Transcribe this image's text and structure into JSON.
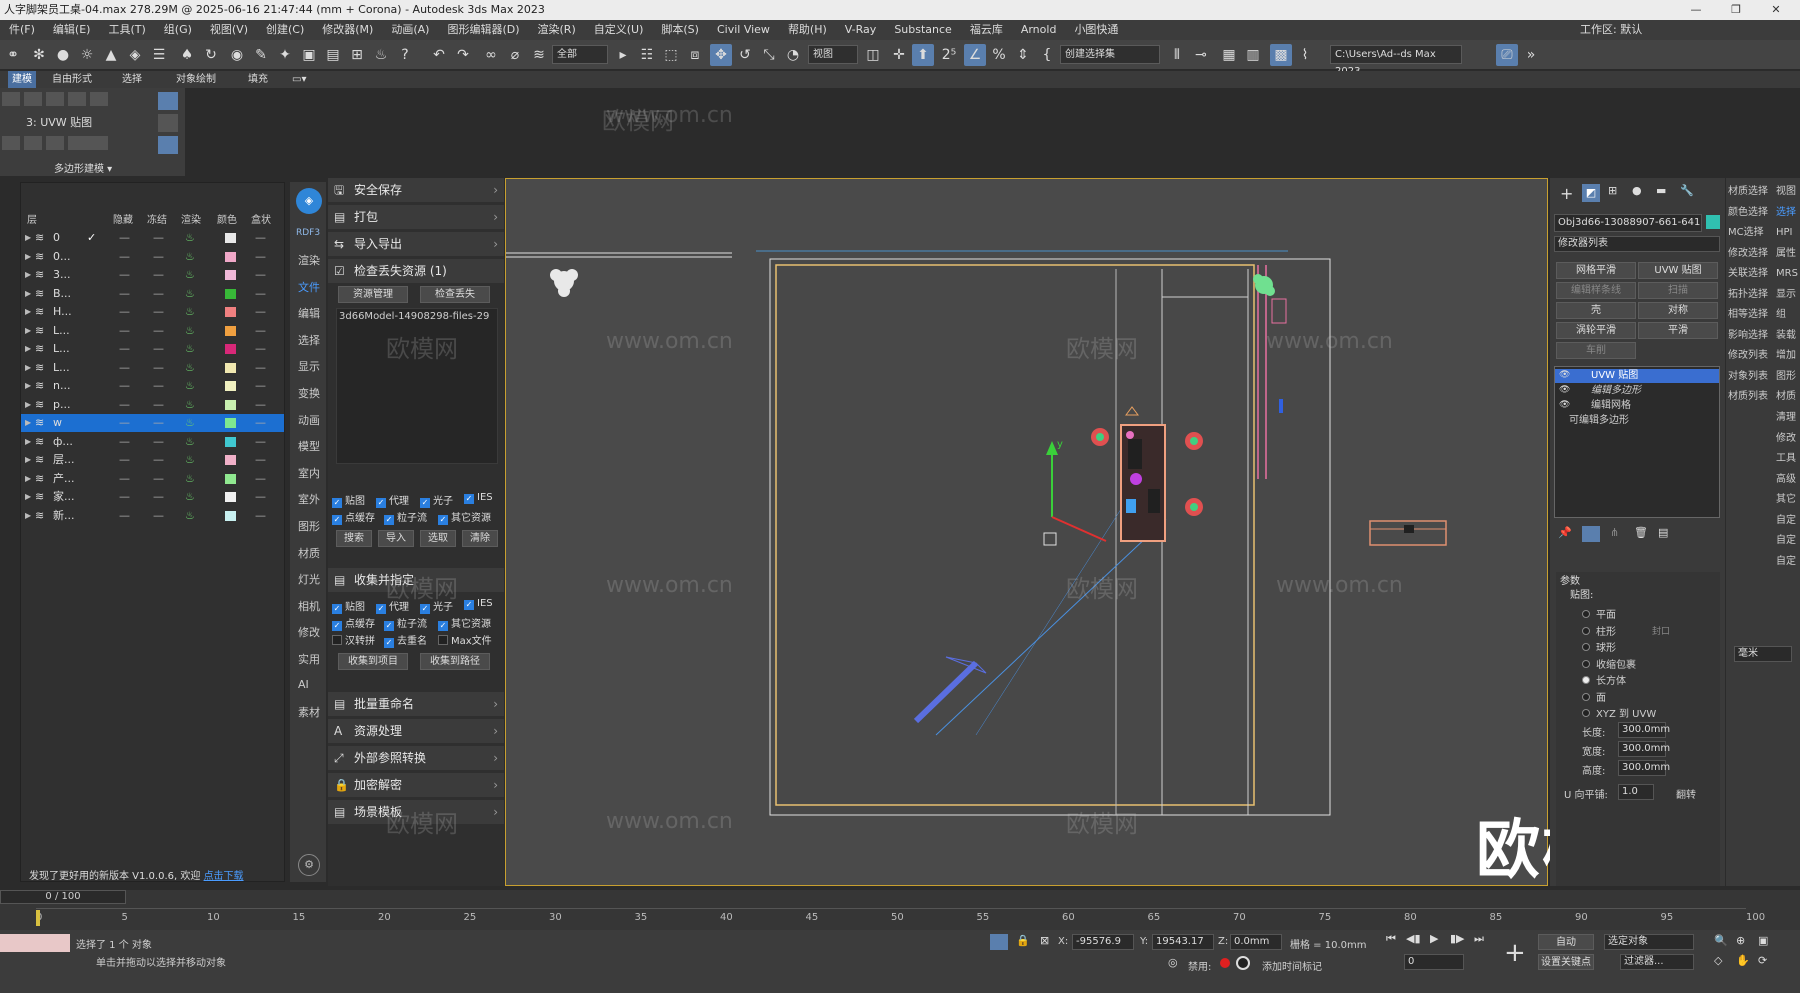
{
  "window": {
    "title": "人字脚架员工桌-04.max  278.29M @ 2025-06-16 21:47:44  (mm + Corona) - Autodesk 3ds Max 2023",
    "controls": [
      "—",
      "❐",
      "✕"
    ]
  },
  "menu": {
    "items": [
      "件(F)",
      "编辑(E)",
      "工具(T)",
      "组(G)",
      "视图(V)",
      "创建(C)",
      "修改器(M)",
      "动画(A)",
      "图形编辑器(D)",
      "渲染(R)",
      "自定义(U)",
      "脚本(S)",
      "Civil View",
      "帮助(H)",
      "V-Ray",
      "Substance",
      "福云库",
      "Arnold",
      "小图快通"
    ],
    "workspace_label": "工作区: 默认"
  },
  "toolbar": {
    "filter_select": "全部",
    "view_select": "视图",
    "selection_set": "创建选择集",
    "path_field": "C:\\Users\\Ad--ds Max 2023"
  },
  "ribbon": {
    "tabs": [
      "建模",
      "自由形式",
      "选择",
      "对象绘制",
      "填充"
    ],
    "modifier_label": "3: UVW 贴图",
    "poly_label": "多边形建模 ▾"
  },
  "layers": {
    "headers": [
      "层",
      "隐藏",
      "冻结",
      "渲染",
      "颜色",
      "盒状"
    ],
    "rows": [
      {
        "name": "0",
        "color": "#e8e8e8",
        "check": "✓",
        "selected": false
      },
      {
        "name": "0...",
        "color": "#f0a8c8",
        "check": "",
        "selected": false
      },
      {
        "name": "3...",
        "color": "#f0b8d8",
        "check": "",
        "selected": false
      },
      {
        "name": "B...",
        "color": "#38b838",
        "check": "",
        "selected": false
      },
      {
        "name": "H...",
        "color": "#f08080",
        "check": "",
        "selected": false
      },
      {
        "name": "L...",
        "color": "#f0a040",
        "check": "",
        "selected": false
      },
      {
        "name": "L...",
        "color": "#d82878",
        "check": "",
        "selected": false
      },
      {
        "name": "L...",
        "color": "#f0e8b0",
        "check": "",
        "selected": false
      },
      {
        "name": "n...",
        "color": "#f0f0c0",
        "check": "",
        "selected": false
      },
      {
        "name": "p...",
        "color": "#c8f0b0",
        "check": "",
        "selected": false
      },
      {
        "name": "w",
        "color": "#7ee890",
        "check": "",
        "selected": true
      },
      {
        "name": "ф...",
        "color": "#40c8d0",
        "check": "",
        "selected": false
      },
      {
        "name": "层...",
        "color": "#f0b0c8",
        "check": "",
        "selected": false
      },
      {
        "name": "产...",
        "color": "#90e890",
        "check": "",
        "selected": false
      },
      {
        "name": "家...",
        "color": "#f0f0f0",
        "check": "",
        "selected": false
      },
      {
        "name": "新...",
        "color": "#c8f0f0",
        "check": "",
        "selected": false
      }
    ],
    "footer_text": "发现了更好用的新版本 V1.0.0.6, 欢迎",
    "footer_link": "点击下载"
  },
  "rdf_strip": {
    "logo": "RDF3",
    "items": [
      "渲染",
      "文件",
      "编辑",
      "选择",
      "显示",
      "变换",
      "动画",
      "模型",
      "室内",
      "室外",
      "图形",
      "材质",
      "灯光",
      "相机",
      "修改",
      "实用",
      "AI",
      "素材"
    ]
  },
  "file_panel": {
    "sections_top": [
      "安全保存",
      "打包",
      "导入导出"
    ],
    "missing_title": "检查丢失资源 (1)",
    "missing_btn1": "资源管理",
    "missing_btn2": "检查丢失",
    "missing_item": "3d66Model-14908298-files-29",
    "checks1": [
      "贴图",
      "代理",
      "光子",
      "IES",
      "点缓存",
      "粒子流",
      "其它资源"
    ],
    "action_btns": [
      "搜索",
      "导入",
      "选取",
      "清除"
    ],
    "collect_title": "收集并指定",
    "checks2": [
      "贴图",
      "代理",
      "光子",
      "IES",
      "点缓存",
      "粒子流",
      "其它资源",
      "汉转拼",
      "去重名",
      "Max文件"
    ],
    "collect_btn1": "收集到项目",
    "collect_btn2": "收集到路径",
    "sections_bottom": [
      "批量重命名",
      "资源处理",
      "外部参照转换",
      "加密解密",
      "场景模板"
    ]
  },
  "viewport": {
    "watermark": "www.om.cn",
    "watermark_cn": "欧模网",
    "brand_overlay": "欧模网",
    "axis_y": "y"
  },
  "command_panel": {
    "object_name": "Obj3d66-13088907-661-641",
    "modifier_list": "修改器列表",
    "mod_buttons": [
      "网格平滑",
      "UVW 贴图",
      "编辑样条线",
      "扫描",
      "壳",
      "对称",
      "涡轮平滑",
      "平滑",
      "车削"
    ],
    "stack": [
      "UVW 贴图",
      "编辑多边形",
      "编辑网格",
      "可编辑多边形"
    ],
    "params_title": "参数",
    "mapping_label": "贴图:",
    "mapping_options": [
      "平面",
      "柱形",
      "球形",
      "收缩包裹",
      "长方体",
      "面",
      "XYZ 到 UVW"
    ],
    "cap_label": "封口",
    "length_label": "长度:",
    "length_value": "300.0mm",
    "width_label": "宽度:",
    "width_value": "300.0mm",
    "height_label": "高度:",
    "height_value": "300.0mm",
    "utile_label": "U 向平铺:",
    "utile_value": "1.0",
    "flip_label": "翻转"
  },
  "right_column": {
    "buttons": [
      [
        "材质选择",
        "视图"
      ],
      [
        "颜色选择",
        "选择"
      ],
      [
        "MC选择",
        "HPI"
      ],
      [
        "修改选择",
        "属性"
      ],
      [
        "关联选择",
        "MRS"
      ],
      [
        "拓扑选择",
        "显示"
      ],
      [
        "相等选择",
        "组"
      ],
      [
        "影响选择",
        "装载"
      ],
      [
        "修改列表",
        "增加"
      ],
      [
        "对象列表",
        "图形"
      ],
      [
        "材质列表",
        "材质"
      ]
    ],
    "single": [
      "清理",
      "修改",
      "工具",
      "高级",
      "其它",
      "自定",
      "自定",
      "自定"
    ],
    "unit": "毫米"
  },
  "timeline": {
    "frame_display": "0 / 100",
    "ticks": [
      "0",
      "5",
      "10",
      "15",
      "20",
      "25",
      "30",
      "35",
      "40",
      "45",
      "50",
      "55",
      "60",
      "65",
      "70",
      "75",
      "80",
      "85",
      "90",
      "95",
      "100"
    ]
  },
  "status": {
    "selected": "选择了 1 个 对象",
    "hint": "单击并拖动以选择并移动对象",
    "x_label": "X:",
    "x_value": "-95576.9",
    "y_label": "Y:",
    "y_value": "19543.17",
    "z_label": "Z:",
    "z_value": "0.0mm",
    "grid": "栅格 = 10.0mm",
    "disabled": "禁用:",
    "add_tag": "添加时间标记",
    "auto": "自动",
    "select_object": "选定对象",
    "set_key": "设置关键点",
    "filter": "过滤器...",
    "frame": "0"
  }
}
